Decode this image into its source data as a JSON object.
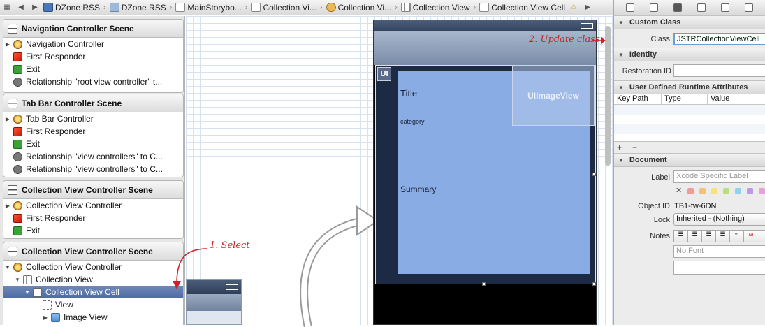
{
  "jumpbar": {
    "crumbs": [
      "DZone RSS",
      "DZone RSS",
      "MainStorybo...",
      "Collection Vi...",
      "Collection Vi...",
      "Collection View",
      "Collection View Cell"
    ]
  },
  "outline": {
    "scenes": [
      {
        "title": "Navigation Controller Scene",
        "items": [
          {
            "label": "Navigation Controller",
            "icon": "controller-icon"
          },
          {
            "label": "First Responder",
            "icon": "first-responder-icon"
          },
          {
            "label": "Exit",
            "icon": "exit-icon"
          },
          {
            "label": "Relationship \"root view controller\" t...",
            "icon": "relationship-icon"
          }
        ]
      },
      {
        "title": "Tab Bar Controller Scene",
        "items": [
          {
            "label": "Tab Bar Controller",
            "icon": "controller-icon"
          },
          {
            "label": "First Responder",
            "icon": "first-responder-icon"
          },
          {
            "label": "Exit",
            "icon": "exit-icon"
          },
          {
            "label": "Relationship \"view controllers\" to C...",
            "icon": "relationship-icon"
          },
          {
            "label": "Relationship \"view controllers\" to C...",
            "icon": "relationship-icon"
          }
        ]
      },
      {
        "title": "Collection View Controller Scene",
        "items": [
          {
            "label": "Collection View Controller",
            "icon": "controller-icon"
          },
          {
            "label": "First Responder",
            "icon": "first-responder-icon"
          },
          {
            "label": "Exit",
            "icon": "exit-icon"
          }
        ]
      },
      {
        "title": "Collection View Controller Scene",
        "items": [
          {
            "label": "Collection View Controller",
            "icon": "controller-icon"
          },
          {
            "label": "Collection View",
            "icon": "collection-view-icon"
          },
          {
            "label": "Collection View Cell",
            "icon": "cell-icon",
            "selected": true
          },
          {
            "label": "View",
            "icon": "view-icon"
          },
          {
            "label": "Image View",
            "icon": "image-view-icon"
          }
        ]
      }
    ]
  },
  "canvas": {
    "badge": "UI",
    "cell_title": "Title",
    "cell_category": "category",
    "cell_summary": "Summary",
    "image_view_label": "UIImageView"
  },
  "annotations": {
    "select": "1. Select",
    "update": "2. Update class"
  },
  "inspector": {
    "custom_class": {
      "header": "Custom Class",
      "class_label": "Class",
      "class_value": "JSTRCollectionViewCell"
    },
    "identity": {
      "header": "Identity",
      "restoration_label": "Restoration ID",
      "restoration_value": ""
    },
    "runtime": {
      "header": "User Defined Runtime Attributes",
      "col_key": "Key Path",
      "col_type": "Type",
      "col_value": "Value",
      "add": "+",
      "remove": "−"
    },
    "document": {
      "header": "Document",
      "label_label": "Label",
      "label_placeholder": "Xcode Specific Label",
      "objectid_label": "Object ID",
      "objectid_value": "TB1-fw-6DN",
      "lock_label": "Lock",
      "lock_value": "Inherited - (Nothing)",
      "notes_label": "Notes",
      "font_placeholder": "No Font",
      "label_colors": [
        "#f09a9a",
        "#f6c07a",
        "#f4e27a",
        "#b8e07a",
        "#8fd3e8",
        "#b89ae8",
        "#e8a0d8"
      ]
    }
  }
}
